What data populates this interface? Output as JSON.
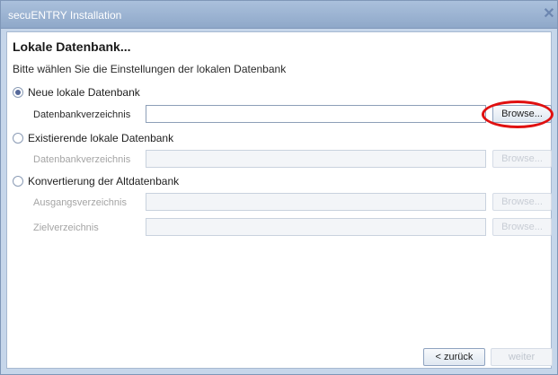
{
  "window": {
    "title": "secuENTRY Installation"
  },
  "page": {
    "heading": "Lokale Datenbank...",
    "subtitle": "Bitte wählen Sie die Einstellungen der lokalen Datenbank"
  },
  "options": [
    {
      "label": "Neue lokale Datenbank",
      "checked": true
    },
    {
      "label": "Existierende lokale Datenbank",
      "checked": false
    },
    {
      "label": "Konvertierung der Altdatenbank",
      "checked": false
    }
  ],
  "fields": [
    {
      "label": "Datenbankverzeichnis",
      "value": "",
      "enabled": true
    },
    {
      "label": "Datenbankverzeichnis",
      "value": "",
      "enabled": false
    },
    {
      "label": "Ausgangsverzeichnis",
      "value": "",
      "enabled": false
    },
    {
      "label": "Zielverzeichnis",
      "value": "",
      "enabled": false
    }
  ],
  "buttons": {
    "browse": "Browse...",
    "back": "< zurück",
    "next": "weiter"
  },
  "colors": {
    "highlight": "#e01010",
    "titlebar": "#9fb4d2"
  }
}
